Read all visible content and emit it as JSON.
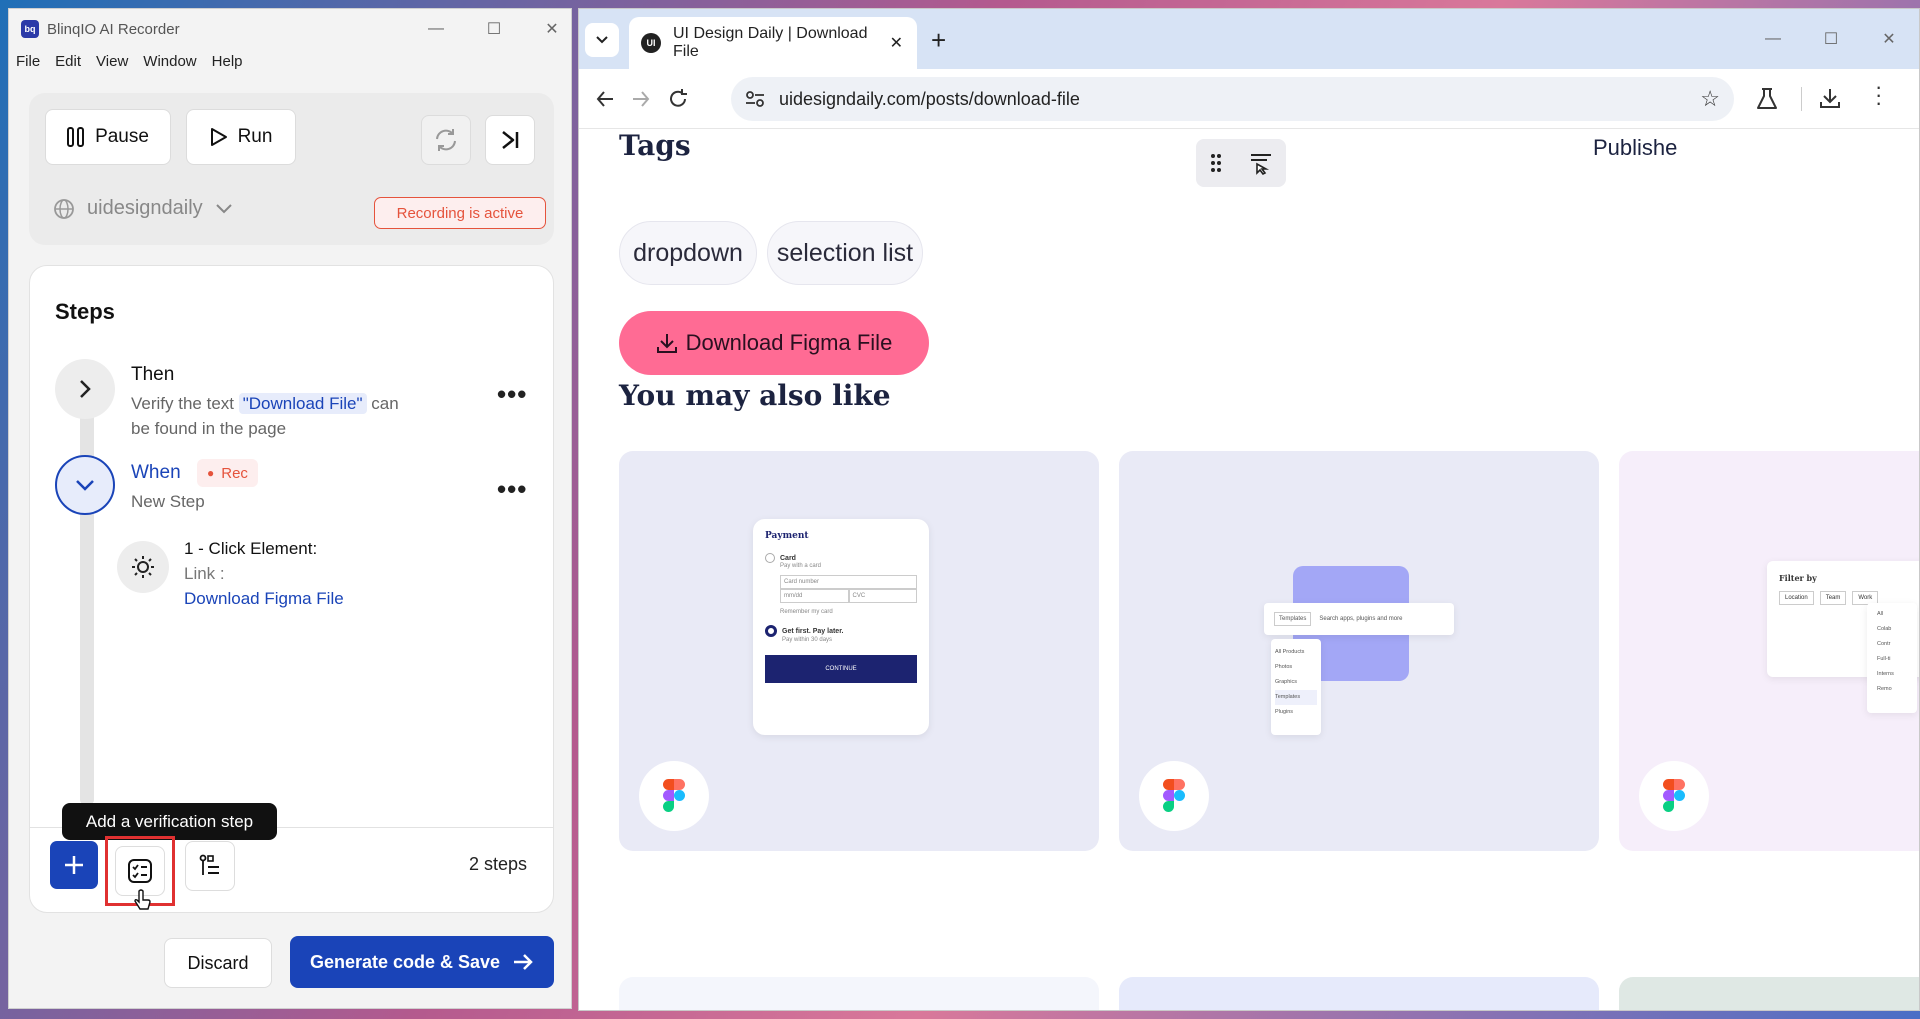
{
  "recorder": {
    "title": "BlinqIO AI Recorder",
    "menu": [
      "File",
      "Edit",
      "View",
      "Window",
      "Help"
    ],
    "pause_label": "Pause",
    "run_label": "Run",
    "project": "uidesigndaily",
    "recording_status": "Recording is active",
    "steps_heading": "Steps",
    "step1": {
      "keyword": "Then",
      "text_before": "Verify the text",
      "highlight": "\"Download File\"",
      "text_after": "can",
      "text_line2": "be found in the page"
    },
    "step2": {
      "keyword": "When",
      "rec_badge": "Rec",
      "subtitle": "New Step"
    },
    "substep": {
      "title": "1 - Click Element:",
      "type": "Link :",
      "link": "Download Figma File"
    },
    "tooltip": "Add a verification step",
    "step_count": "2 steps",
    "discard_label": "Discard",
    "generate_label": "Generate code & Save"
  },
  "browser": {
    "tab_title": "UI Design Daily | Download File",
    "favicon_text": "UI",
    "url": "uidesigndaily.com/posts/download-file",
    "page": {
      "tags_heading": "Tags",
      "published_label": "Publishe",
      "tags": [
        "dropdown",
        "selection list"
      ],
      "download_button": "Download Figma File",
      "also_like_heading": "You may also like",
      "card1": {
        "heading": "Payment",
        "opt1": "Card",
        "opt1_sub": "Pay with a card",
        "field1": "Card number",
        "field2": "mm/dd",
        "field3": "CVC",
        "remember": "Remember my card",
        "opt2": "Get first. Pay later.",
        "opt2_sub": "Pay within 30 days",
        "cta": "CONTINUE"
      },
      "card2": {
        "dropdown": "Templates",
        "search": "Search apps, plugins and more",
        "items": [
          "All Products",
          "Photos",
          "Graphics",
          "Templates",
          "Plugins"
        ]
      },
      "card3": {
        "heading": "Filter by",
        "chips": [
          "Location",
          "Team",
          "Work"
        ],
        "items": [
          "All",
          "Colab",
          "Contr",
          "Full-ti",
          "Interns",
          "Remo"
        ]
      }
    }
  },
  "colors": {
    "accent": "#1a44b8",
    "download_pink": "#ff6b94",
    "recording": "#e5533c"
  }
}
